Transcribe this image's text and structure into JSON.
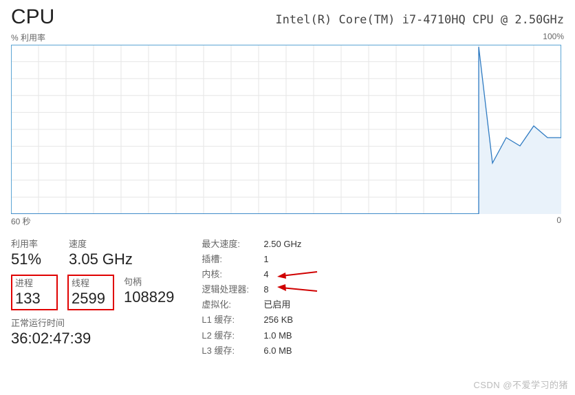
{
  "header": {
    "title": "CPU",
    "model": "Intel(R) Core(TM) i7-4710HQ CPU @ 2.50GHz"
  },
  "chart": {
    "y_label": "% 利用率",
    "y_max": "100%",
    "x_left": "60 秒",
    "x_right": "0"
  },
  "chart_data": {
    "type": "line",
    "title": "% 利用率",
    "xlabel": "秒",
    "ylabel": "利用率 %",
    "xlim": [
      60,
      0
    ],
    "ylim": [
      0,
      100
    ],
    "series": [
      {
        "name": "CPU %",
        "x": [
          60,
          58,
          56,
          54,
          52,
          50,
          48,
          46,
          44,
          42,
          40,
          38,
          36,
          34,
          32,
          30,
          28,
          26,
          24,
          22,
          20,
          18,
          16,
          14,
          12,
          10,
          8,
          6,
          4,
          2,
          0
        ],
        "values": [
          0,
          0,
          0,
          0,
          0,
          0,
          0,
          0,
          0,
          0,
          0,
          0,
          0,
          0,
          0,
          0,
          0,
          0,
          0,
          0,
          0,
          0,
          0,
          0,
          100,
          30,
          45,
          40,
          52,
          45,
          45
        ]
      }
    ]
  },
  "metrics": {
    "utilization_label": "利用率",
    "utilization_value": "51%",
    "speed_label": "速度",
    "speed_value": "3.05 GHz",
    "processes_label": "进程",
    "processes_value": "133",
    "threads_label": "线程",
    "threads_value": "2599",
    "handles_label": "句柄",
    "handles_value": "108829",
    "uptime_label": "正常运行时间",
    "uptime_value": "36:02:47:39"
  },
  "specs": {
    "max_speed_k": "最大速度:",
    "max_speed_v": "2.50 GHz",
    "sockets_k": "插槽:",
    "sockets_v": "1",
    "cores_k": "内核:",
    "cores_v": "4",
    "logical_k": "逻辑处理器:",
    "logical_v": "8",
    "virt_k": "虚拟化:",
    "virt_v": "已启用",
    "l1_k": "L1 缓存:",
    "l1_v": "256 KB",
    "l2_k": "L2 缓存:",
    "l2_v": "1.0 MB",
    "l3_k": "L3 缓存:",
    "l3_v": "6.0 MB"
  },
  "watermark": "CSDN @不爱学习的猪"
}
